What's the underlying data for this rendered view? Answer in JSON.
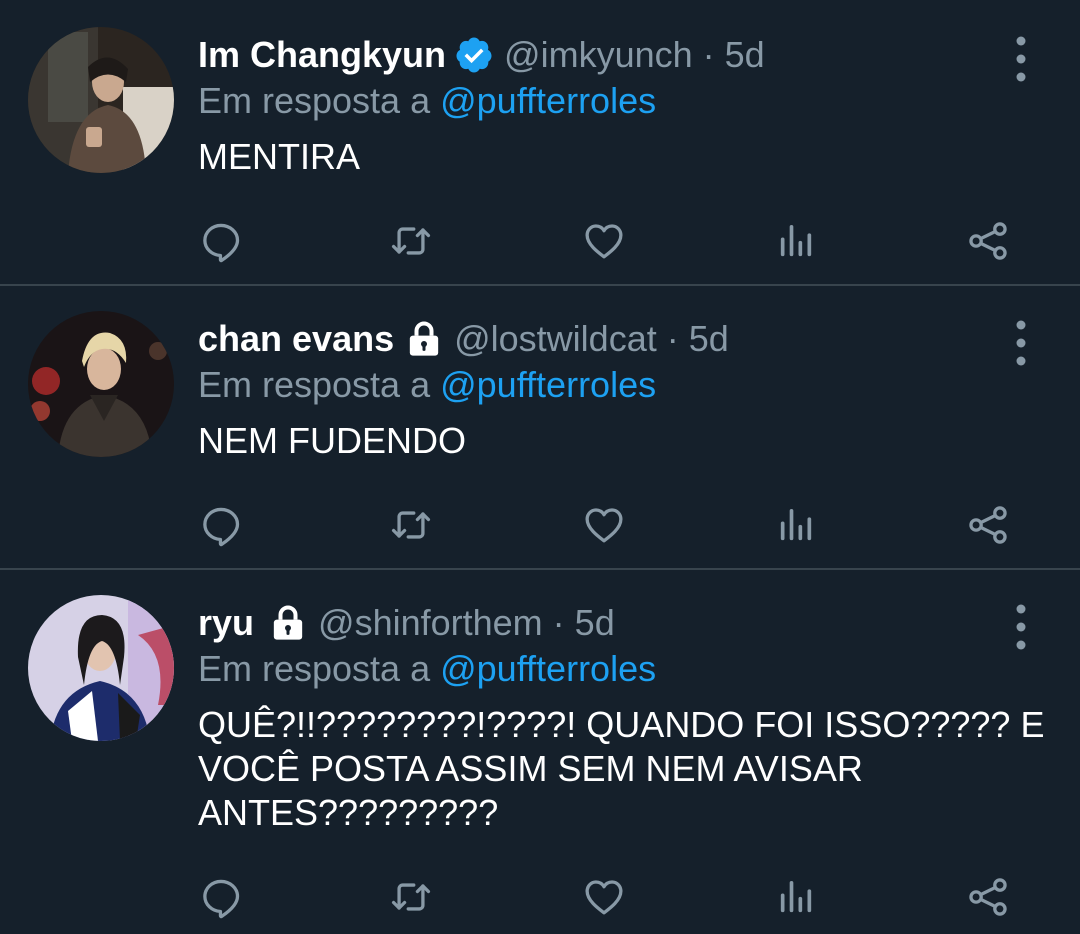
{
  "tweets": [
    {
      "name": "Im Changkyun",
      "verified": true,
      "locked": false,
      "handle": "@imkyunch",
      "separator": "·",
      "time": "5d",
      "reply_prefix": "Em resposta a ",
      "reply_to": "@puffterroles",
      "text": "MENTIRA"
    },
    {
      "name": "chan evans",
      "verified": false,
      "locked": true,
      "handle": "@lostwildcat",
      "separator": "·",
      "time": "5d",
      "reply_prefix": "Em resposta a ",
      "reply_to": "@puffterroles",
      "text": "NEM FUDENDO"
    },
    {
      "name": "ryu",
      "verified": false,
      "locked": true,
      "handle": "@shinforthem",
      "separator": "·",
      "time": "5d",
      "reply_prefix": "Em resposta a ",
      "reply_to": "@puffterroles",
      "text_lines": [
        "QUÊ?!!????????!????! QUANDO FOI ISSO????? E",
        "VOCÊ POSTA ASSIM SEM NEM AVISAR",
        "ANTES?????????"
      ]
    }
  ],
  "icons": {
    "reply": "reply-icon",
    "retweet": "retweet-icon",
    "like": "heart-icon",
    "analytics": "analytics-icon",
    "share": "share-icon",
    "more": "more-vertical-icon",
    "verified": "verified-badge-icon",
    "locked": "lock-icon"
  },
  "colors": {
    "background": "#15202b",
    "text": "#ffffff",
    "secondary": "#8899a6",
    "link": "#1da1f2",
    "divider": "#38444d",
    "verified": "#1da1f2"
  }
}
